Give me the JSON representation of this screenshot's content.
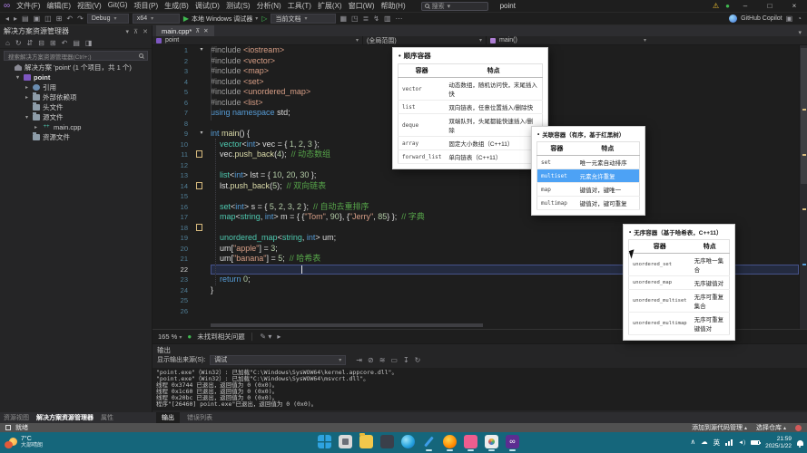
{
  "window": {
    "minimize": "–",
    "maximize": "□",
    "close": "×",
    "warning_icon": "⚠",
    "live_dot": "●",
    "app_logo": "∞"
  },
  "menu": {
    "items": [
      "文件(F)",
      "编辑(E)",
      "视图(V)",
      "Git(G)",
      "项目(P)",
      "生成(B)",
      "调试(D)",
      "测试(S)",
      "分析(N)",
      "工具(T)",
      "扩展(X)",
      "窗口(W)",
      "帮助(H)"
    ],
    "search_label": "搜索",
    "project_label": "point"
  },
  "toolbar": {
    "left_icons": [
      {
        "name": "navigate-back-icon",
        "glyph": "◂"
      },
      {
        "name": "navigate-forward-icon",
        "glyph": "▸"
      },
      {
        "name": "new-file-icon",
        "glyph": "▤"
      },
      {
        "name": "open-file-icon",
        "glyph": "▣"
      },
      {
        "name": "save-icon",
        "glyph": "◫"
      },
      {
        "name": "save-all-icon",
        "glyph": "⊞"
      },
      {
        "name": "undo-icon",
        "glyph": "↶"
      },
      {
        "name": "redo-icon",
        "glyph": "↷"
      }
    ],
    "config": "Debug",
    "platform": "x64",
    "run_label": "本地 Windows 调试器",
    "secondary_combo": "当前文档",
    "right_icons": [
      {
        "name": "attach-icon",
        "glyph": "▦"
      },
      {
        "name": "breakpoints-icon",
        "glyph": "◳"
      },
      {
        "name": "list-icon",
        "glyph": "≣"
      },
      {
        "name": "flash-icon",
        "glyph": "↯"
      },
      {
        "name": "grid-icon",
        "glyph": "▥"
      },
      {
        "name": "more-icon",
        "glyph": "⋯"
      }
    ],
    "copilot_label": "GitHub Copilot",
    "copilot_icons": [
      {
        "name": "share-icon",
        "glyph": "▣"
      },
      {
        "name": "feedback-icon",
        "glyph": "◔"
      }
    ]
  },
  "tabstrip": {
    "active_tab": "main.cpp*",
    "pin_icon": "⊼",
    "close_icon": "✕",
    "overflow_icon": "▾"
  },
  "breadcrumb": {
    "project": "point",
    "scope": "(全局范围)",
    "member": "main()"
  },
  "explorer": {
    "title": "解决方案资源管理器",
    "header_icons": [
      {
        "name": "dock-icon",
        "glyph": "▾"
      },
      {
        "name": "pin-icon",
        "glyph": "⊼"
      },
      {
        "name": "close-icon",
        "glyph": "✕"
      }
    ],
    "toolbar_icons": [
      {
        "name": "home-icon",
        "glyph": "⌂"
      },
      {
        "name": "refresh-icon",
        "glyph": "↻"
      },
      {
        "name": "sync-icon",
        "glyph": "⇵"
      },
      {
        "name": "collapse-all-icon",
        "glyph": "⊟"
      },
      {
        "name": "show-all-files-icon",
        "glyph": "⊞"
      },
      {
        "name": "undo-icon",
        "glyph": "↶"
      },
      {
        "name": "properties-icon",
        "glyph": "▤"
      },
      {
        "name": "preview-icon",
        "glyph": "◨"
      }
    ],
    "search_placeholder": "搜索解决方案资源管理器(Ctrl+;)",
    "tree": [
      {
        "depth": 0,
        "arrow": "",
        "icon": "solution-icon",
        "label": "解决方案 'point' (1 个项目，共 1 个)",
        "bold": false
      },
      {
        "depth": 1,
        "arrow": "▾",
        "icon": "project-icon",
        "label": "point",
        "bold": true
      },
      {
        "depth": 2,
        "arrow": "▸",
        "icon": "references-icon",
        "label": "引用",
        "bold": false
      },
      {
        "depth": 2,
        "arrow": "▸",
        "icon": "folder-icon",
        "label": "外部依赖项",
        "bold": false
      },
      {
        "depth": 2,
        "arrow": "",
        "icon": "folder-icon",
        "label": "头文件",
        "bold": false
      },
      {
        "depth": 2,
        "arrow": "▾",
        "icon": "folder-icon",
        "label": "源文件",
        "bold": false
      },
      {
        "depth": 3,
        "arrow": "▸",
        "icon": "cpp-file-icon",
        "label": "main.cpp",
        "bold": false
      },
      {
        "depth": 2,
        "arrow": "",
        "icon": "folder-icon",
        "label": "资源文件",
        "bold": false
      }
    ],
    "bottom_tabs": [
      {
        "label": "资源视图",
        "active": false
      },
      {
        "label": "解决方案资源管理器",
        "active": true
      },
      {
        "label": "属性",
        "active": false
      }
    ]
  },
  "editor": {
    "zoom_level": "165 %",
    "health_status": "未找到相关问题",
    "lines": [
      {
        "n": 1,
        "fold": true,
        "segs": [
          [
            "pp",
            "#include"
          ],
          [
            "pl",
            " "
          ],
          [
            "str",
            "<iostream>"
          ]
        ]
      },
      {
        "n": 2,
        "segs": [
          [
            "pp",
            "#include"
          ],
          [
            "pl",
            " "
          ],
          [
            "str",
            "<vector>"
          ]
        ]
      },
      {
        "n": 3,
        "segs": [
          [
            "pp",
            "#include"
          ],
          [
            "pl",
            " "
          ],
          [
            "str",
            "<map>"
          ]
        ]
      },
      {
        "n": 4,
        "segs": [
          [
            "pp",
            "#include"
          ],
          [
            "pl",
            " "
          ],
          [
            "str",
            "<set>"
          ]
        ]
      },
      {
        "n": 5,
        "segs": [
          [
            "pp",
            "#include"
          ],
          [
            "pl",
            " "
          ],
          [
            "str",
            "<unordered_map>"
          ]
        ]
      },
      {
        "n": 6,
        "segs": [
          [
            "pp",
            "#include"
          ],
          [
            "pl",
            " "
          ],
          [
            "str",
            "<list>"
          ]
        ]
      },
      {
        "n": 7,
        "segs": [
          [
            "kw",
            "using"
          ],
          [
            "pl",
            " "
          ],
          [
            "kw",
            "namespace"
          ],
          [
            "pl",
            " std;"
          ]
        ]
      },
      {
        "n": 8,
        "segs": []
      },
      {
        "n": 9,
        "fold": true,
        "segs": [
          [
            "kw",
            "int"
          ],
          [
            "pl",
            " "
          ],
          [
            "fn",
            "main"
          ],
          [
            "pl",
            "() {"
          ]
        ]
      },
      {
        "n": 10,
        "segs": [
          [
            "pl",
            "    "
          ],
          [
            "ty",
            "vector"
          ],
          [
            "pl",
            "<"
          ],
          [
            "kw",
            "int"
          ],
          [
            "pl",
            "> vec = { "
          ],
          [
            "num",
            "1"
          ],
          [
            "pl",
            ", "
          ],
          [
            "num",
            "2"
          ],
          [
            "pl",
            ", "
          ],
          [
            "num",
            "3"
          ],
          [
            "pl",
            " };"
          ]
        ]
      },
      {
        "n": 11,
        "mark": true,
        "segs": [
          [
            "pl",
            "    vec."
          ],
          [
            "fn",
            "push_back"
          ],
          [
            "pl",
            "("
          ],
          [
            "num",
            "4"
          ],
          [
            "pl",
            ");  "
          ],
          [
            "cm",
            "// 动态数组"
          ]
        ]
      },
      {
        "n": 12,
        "segs": []
      },
      {
        "n": 13,
        "segs": [
          [
            "pl",
            "    "
          ],
          [
            "ty",
            "list"
          ],
          [
            "pl",
            "<"
          ],
          [
            "kw",
            "int"
          ],
          [
            "pl",
            "> lst = { "
          ],
          [
            "num",
            "10"
          ],
          [
            "pl",
            ", "
          ],
          [
            "num",
            "20"
          ],
          [
            "pl",
            ", "
          ],
          [
            "num",
            "30"
          ],
          [
            "pl",
            " };"
          ]
        ]
      },
      {
        "n": 14,
        "mark": true,
        "segs": [
          [
            "pl",
            "    lst."
          ],
          [
            "fn",
            "push_back"
          ],
          [
            "pl",
            "("
          ],
          [
            "num",
            "5"
          ],
          [
            "pl",
            ");  "
          ],
          [
            "cm",
            "// 双向链表"
          ]
        ]
      },
      {
        "n": 15,
        "segs": []
      },
      {
        "n": 16,
        "segs": [
          [
            "pl",
            "    "
          ],
          [
            "ty",
            "set"
          ],
          [
            "pl",
            "<"
          ],
          [
            "kw",
            "int"
          ],
          [
            "pl",
            "> s = { "
          ],
          [
            "num",
            "5"
          ],
          [
            "pl",
            ", "
          ],
          [
            "num",
            "2"
          ],
          [
            "pl",
            ", "
          ],
          [
            "num",
            "3"
          ],
          [
            "pl",
            ", "
          ],
          [
            "num",
            "2"
          ],
          [
            "pl",
            " };  "
          ],
          [
            "cm",
            "// 自动去重排序"
          ]
        ]
      },
      {
        "n": 17,
        "segs": [
          [
            "pl",
            "    "
          ],
          [
            "ty",
            "map"
          ],
          [
            "pl",
            "<"
          ],
          [
            "ty",
            "string"
          ],
          [
            "pl",
            ", "
          ],
          [
            "kw",
            "int"
          ],
          [
            "pl",
            "> m = { {"
          ],
          [
            "str",
            "\"Tom\""
          ],
          [
            "pl",
            ", "
          ],
          [
            "num",
            "90"
          ],
          [
            "pl",
            "}, {"
          ],
          [
            "str",
            "\"Jerry\""
          ],
          [
            "pl",
            ", "
          ],
          [
            "num",
            "85"
          ],
          [
            "pl",
            "} };  "
          ],
          [
            "cm",
            "// 字典"
          ]
        ]
      },
      {
        "n": 18,
        "mark": true,
        "segs": []
      },
      {
        "n": 19,
        "segs": [
          [
            "pl",
            "    "
          ],
          [
            "ty",
            "unordered_map"
          ],
          [
            "pl",
            "<"
          ],
          [
            "ty",
            "string"
          ],
          [
            "pl",
            ", "
          ],
          [
            "kw",
            "int"
          ],
          [
            "pl",
            "> um;"
          ]
        ]
      },
      {
        "n": 20,
        "segs": [
          [
            "pl",
            "    um["
          ],
          [
            "str",
            "\"apple\""
          ],
          [
            "pl",
            "] = "
          ],
          [
            "num",
            "3"
          ],
          [
            "pl",
            ";"
          ]
        ]
      },
      {
        "n": 21,
        "segs": [
          [
            "pl",
            "    um["
          ],
          [
            "str",
            "\"banana\""
          ],
          [
            "pl",
            "] = "
          ],
          [
            "num",
            "5"
          ],
          [
            "pl",
            ";  "
          ],
          [
            "cm",
            "// 哈希表"
          ]
        ]
      },
      {
        "n": 22,
        "current": true,
        "segs": [
          [
            "pl",
            "        "
          ]
        ]
      },
      {
        "n": 23,
        "segs": [
          [
            "pl",
            "    "
          ],
          [
            "kw",
            "return"
          ],
          [
            "pl",
            " "
          ],
          [
            "num",
            "0"
          ],
          [
            "pl",
            ";"
          ]
        ]
      },
      {
        "n": 24,
        "segs": [
          [
            "pl",
            "}"
          ]
        ]
      },
      {
        "n": 25,
        "segs": []
      },
      {
        "n": 26,
        "segs": []
      }
    ]
  },
  "popups": [
    {
      "title": "顺序容器",
      "headers": [
        "容器",
        "特点"
      ],
      "rows": [
        {
          "name": "vector",
          "desc": "动态数组，随机访问快，末尾插入快",
          "selected": false
        },
        {
          "name": "list",
          "desc": "双向链表，任意位置插入/删除快",
          "selected": false
        },
        {
          "name": "deque",
          "desc": "双端队列，头尾都能快速插入/删除",
          "selected": false
        },
        {
          "name": "array",
          "desc": "固定大小数组（C++11）",
          "selected": false
        },
        {
          "name": "forward_list",
          "desc": "单向链表（C++11）",
          "selected": false
        }
      ]
    },
    {
      "title": "关联容器（有序，基于红黑树）",
      "headers": [
        "容器",
        "特点"
      ],
      "rows": [
        {
          "name": "set",
          "desc": "唯一元素自动排序",
          "selected": false
        },
        {
          "name": "multiset",
          "desc": "元素允许重复",
          "selected": true
        },
        {
          "name": "map",
          "desc": "键值对，键唯一",
          "selected": false
        },
        {
          "name": "multimap",
          "desc": "键值对，键可重复",
          "selected": false
        }
      ]
    },
    {
      "title": "无序容器（基于哈希表，C++11）",
      "headers": [
        "容器",
        "特点"
      ],
      "rows": [
        {
          "name": "unordered_set",
          "desc": "无序唯一集合",
          "selected": false
        },
        {
          "name": "unordered_map",
          "desc": "无序键值对",
          "selected": false
        },
        {
          "name": "unordered_multiset",
          "desc": "无序可重复集合",
          "selected": false
        },
        {
          "name": "unordered_multimap",
          "desc": "无序可重复键值对",
          "selected": false
        }
      ]
    }
  ],
  "output": {
    "title": "输出",
    "source_label": "显示输出来源(S):",
    "source_value": "调试",
    "toolbar_icons": [
      {
        "name": "goto-icon",
        "glyph": "⇥"
      },
      {
        "name": "clear-icon",
        "glyph": "⊘"
      },
      {
        "name": "wrap-icon",
        "glyph": "≋"
      },
      {
        "name": "collapse-icon",
        "glyph": "▭"
      },
      {
        "name": "save-log-icon",
        "glyph": "↧"
      },
      {
        "name": "refresh-icon",
        "glyph": "↻"
      }
    ],
    "lines": [
      "\"point.exe\"（Win32）: 已加载\"C:\\Windows\\SysWOW64\\kernel.appcore.dll\"。",
      "\"point.exe\"（Win32）: 已加载\"C:\\Windows\\SysWOW64\\msvcrt.dll\"。",
      "线程 0x3744 已退出，返回值为 0 (0x0)。",
      "线程 0x1c60 已退出，返回值为 0 (0x0)。",
      "线程 0x20bc 已退出，返回值为 0 (0x0)。",
      "程序\"[26460] point.exe\"已退出，返回值为 0 (0x0)。"
    ],
    "tabs": [
      {
        "label": "输出",
        "active": true
      },
      {
        "label": "错误列表",
        "active": false
      }
    ]
  },
  "statusbar": {
    "ready_label": "就绪",
    "add_source_control": "添加到源代码管理",
    "select_repo": "选择仓库"
  },
  "taskbar": {
    "weather_temp": "7°C",
    "weather_desc": "大部晴朗",
    "apps": [
      {
        "name": "start-button",
        "css": "icon-start",
        "running": false,
        "glyph": ""
      },
      {
        "name": "widgets-icon",
        "css": "icon-widgets",
        "running": false,
        "glyph": ""
      },
      {
        "name": "file-explorer-icon",
        "css": "icon-folder",
        "running": false,
        "glyph": ""
      },
      {
        "name": "dark-app-icon",
        "css": "icon-darkapp",
        "running": false,
        "glyph": ""
      },
      {
        "name": "edge-browser-icon",
        "css": "icon-edge",
        "running": false,
        "glyph": ""
      },
      {
        "name": "pen-app-icon",
        "css": "icon-pen",
        "running": true,
        "glyph": ""
      },
      {
        "name": "firefox-icon",
        "css": "icon-firefox",
        "running": true,
        "glyph": ""
      },
      {
        "name": "pink-app-icon",
        "css": "icon-pink",
        "running": true,
        "glyph": ""
      },
      {
        "name": "photos-app-icon",
        "css": "icon-photos",
        "running": true,
        "glyph": ""
      },
      {
        "name": "visual-studio-icon",
        "css": "icon-vs",
        "running": true,
        "glyph": "∞"
      }
    ],
    "tray_glyphs": [
      {
        "name": "hidden-icons-chevron",
        "glyph": "∧"
      },
      {
        "name": "onedrive-icon",
        "glyph": "☁"
      },
      {
        "name": "ime-indicator",
        "glyph": "英"
      }
    ],
    "time": "21:59",
    "date": "2025/1/22"
  }
}
